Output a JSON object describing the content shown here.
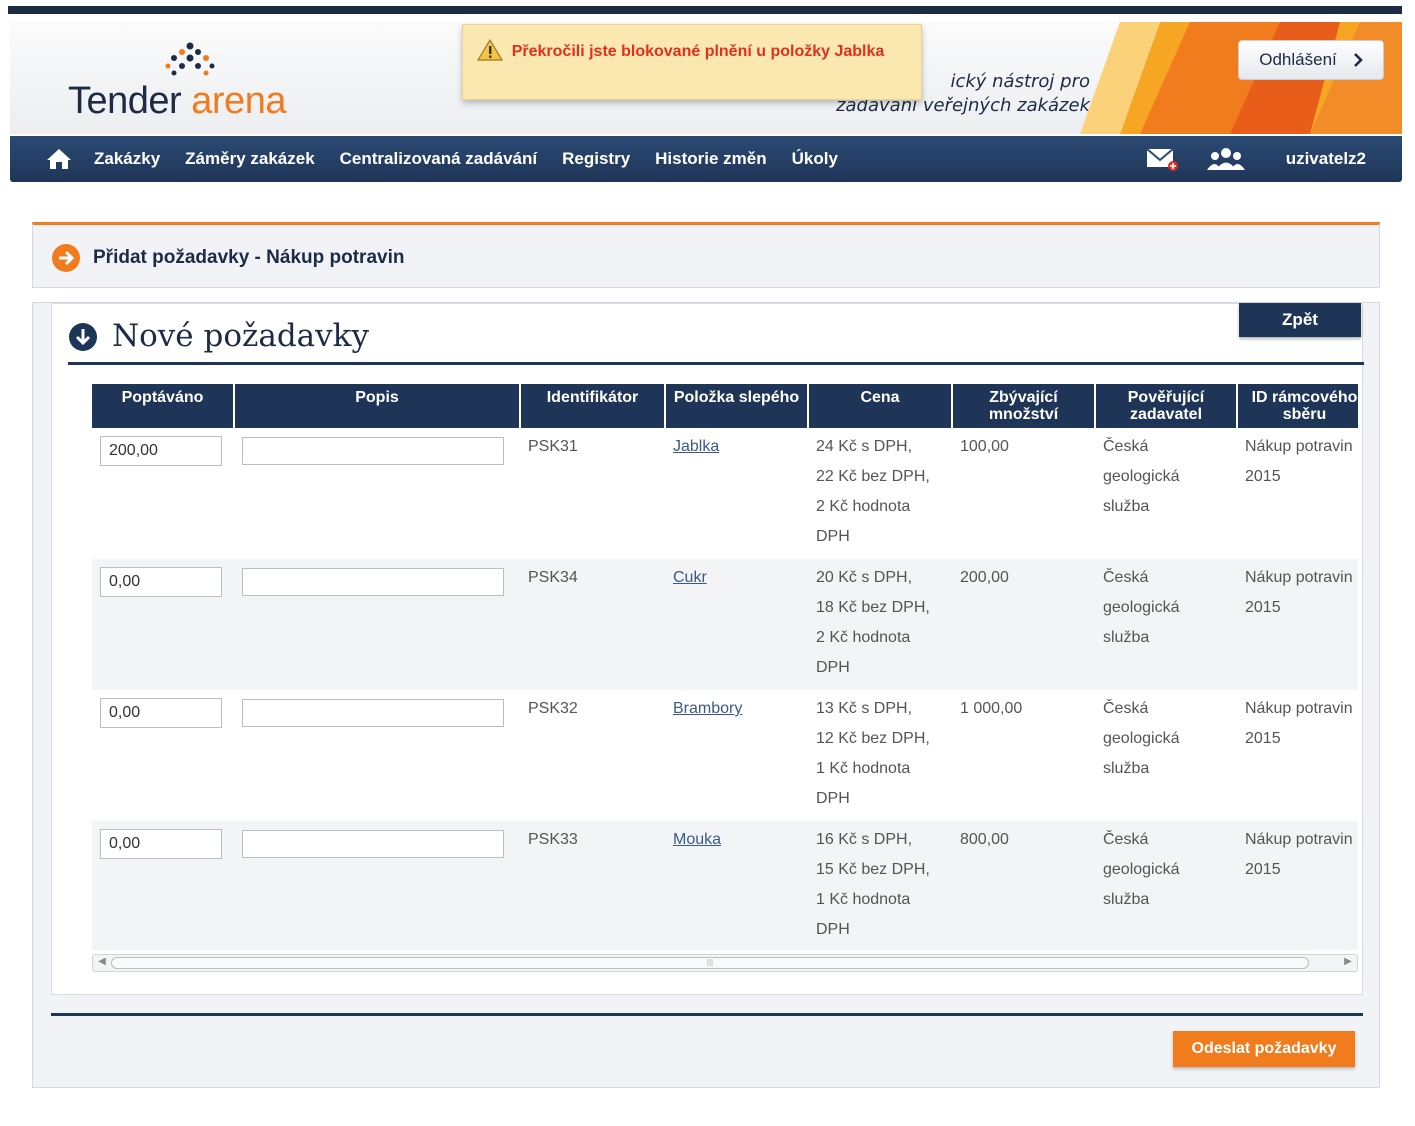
{
  "header": {
    "logo": {
      "word1": "Tender",
      "word2": "arena"
    },
    "tagline_line1": "ický nástroj pro",
    "tagline_line2": "zadávání veřejných zakázek",
    "logout_label": "Odhlášení"
  },
  "alert": {
    "icon": "warning-icon",
    "message": "Překročili jste blokované plnění u položky Jablka"
  },
  "nav": {
    "items": [
      "Zakázky",
      "Záměry zakázek",
      "Centralizovaná zadávání",
      "Registry",
      "Historie změn",
      "Úkoly"
    ],
    "username": "uzivatelz2"
  },
  "breadcrumb": "Přidat požadavky - Nákup potravin",
  "section": {
    "title": "Nové požadavky",
    "back_label": "Zpět",
    "submit_label": "Odeslat požadavky"
  },
  "table": {
    "headers": [
      "Poptáváno",
      "Popis",
      "Identifikátor",
      "Položka slepého",
      "Cena",
      "Zbývající množství",
      "Pověřující zadavatel",
      "ID rámcového sběru"
    ],
    "rows": [
      {
        "poptavano": "200,00",
        "popis": "",
        "id": "PSK31",
        "polozka": "Jablka",
        "cena": [
          "24 Kč s DPH,",
          "22 Kč bez DPH,",
          "2 Kč hodnota",
          "DPH"
        ],
        "zbyvajici": "100,00",
        "zadavatel": [
          "Česká",
          "geologická",
          "služba"
        ],
        "sber": [
          "Nákup potravin",
          "2015"
        ]
      },
      {
        "poptavano": "0,00",
        "popis": "",
        "id": "PSK34",
        "polozka": "Cukr",
        "cena": [
          "20 Kč s DPH,",
          "18 Kč bez DPH,",
          "2 Kč hodnota",
          "DPH"
        ],
        "zbyvajici": "200,00",
        "zadavatel": [
          "Česká",
          "geologická",
          "služba"
        ],
        "sber": [
          "Nákup potravin",
          "2015"
        ]
      },
      {
        "poptavano": "0,00",
        "popis": "",
        "id": "PSK32",
        "polozka": "Brambory",
        "cena": [
          "13 Kč s DPH,",
          "12 Kč bez DPH,",
          "1 Kč hodnota",
          "DPH"
        ],
        "zbyvajici": "1 000,00",
        "zadavatel": [
          "Česká",
          "geologická",
          "služba"
        ],
        "sber": [
          "Nákup potravin",
          "2015"
        ]
      },
      {
        "poptavano": "0,00",
        "popis": "",
        "id": "PSK33",
        "polozka": "Mouka",
        "cena": [
          "16 Kč s DPH,",
          "15 Kč bez DPH,",
          "1 Kč hodnota",
          "DPH"
        ],
        "zbyvajici": "800,00",
        "zadavatel": [
          "Česká",
          "geologická",
          "služba"
        ],
        "sber": [
          "Nákup potravin",
          "2015"
        ]
      }
    ]
  },
  "colors": {
    "navy": "#1f3558",
    "orange": "#f07c1e",
    "alert_bg": "#fbe8b0",
    "alert_text": "#e0301e"
  }
}
